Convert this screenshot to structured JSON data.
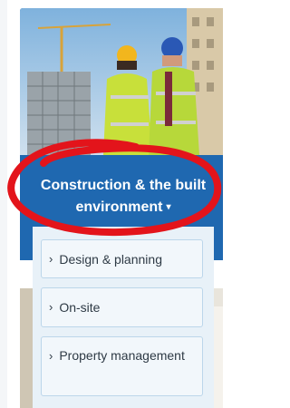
{
  "card": {
    "title": "Construction & the built environment",
    "caret": "▾"
  },
  "dropdown": {
    "items": [
      {
        "chevron": "›",
        "label": "Design & planning"
      },
      {
        "chevron": "›",
        "label": "On-site"
      },
      {
        "chevron": "›",
        "label": "Property management"
      }
    ]
  },
  "colors": {
    "card_blue": "#1f68b0",
    "dropdown_bg": "#e8f1f8",
    "item_border": "#bcd6ea",
    "annotation_red": "#e3141b"
  }
}
